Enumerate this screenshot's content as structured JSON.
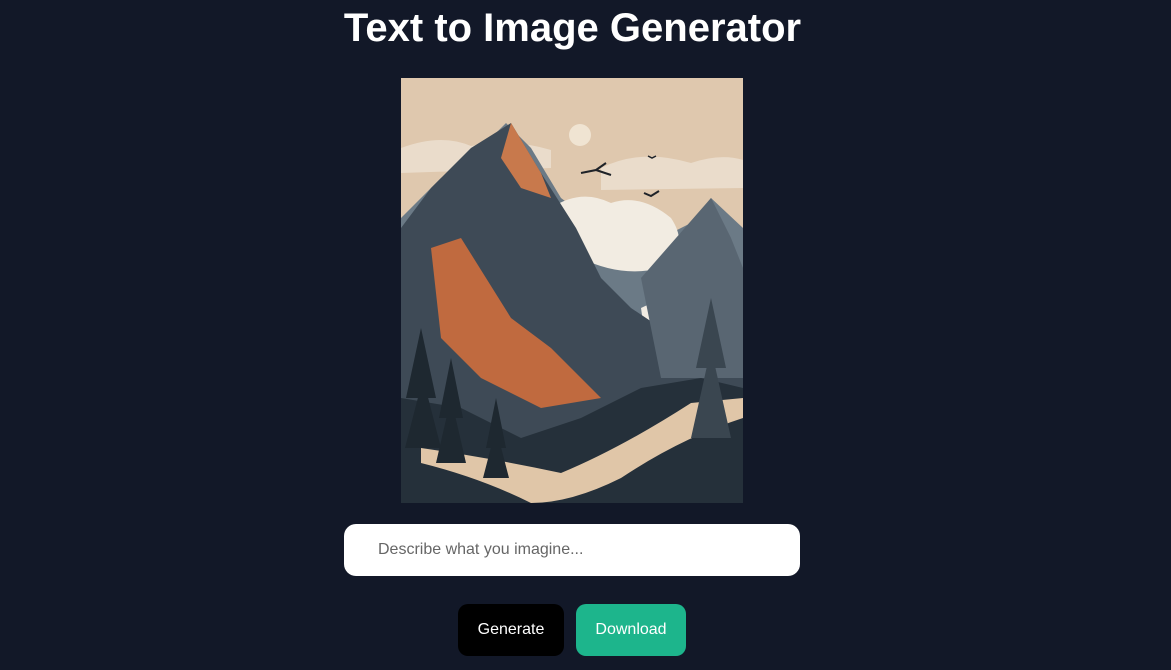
{
  "header": {
    "title": "Text to Image Generator"
  },
  "preview": {
    "alt": "Generated mountain landscape illustration"
  },
  "prompt": {
    "value": "",
    "placeholder": "Describe what you imagine..."
  },
  "actions": {
    "generate_label": "Generate",
    "download_label": "Download"
  },
  "colors": {
    "background": "#121828",
    "generate": "#000000",
    "download": "#1db58c",
    "text": "#ffffff"
  }
}
